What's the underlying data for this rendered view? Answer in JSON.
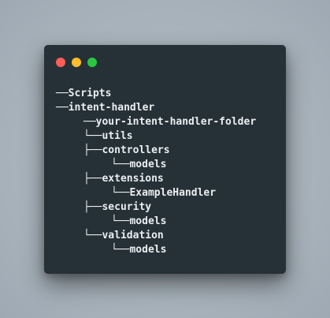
{
  "window": {
    "controls": [
      {
        "name": "close",
        "color": "#ff5f56"
      },
      {
        "name": "minimize",
        "color": "#ffbd2e"
      },
      {
        "name": "zoom",
        "color": "#27c93f"
      }
    ]
  },
  "tree": {
    "lines": [
      "──Scripts",
      "──intent-handler",
      "──your-intent-handler-folder",
      "└──utils",
      "├──controllers",
      "└──models",
      "├──extensions",
      "└──ExampleHandler",
      "├──security",
      "└──models",
      "└──validation",
      "└──models"
    ]
  }
}
